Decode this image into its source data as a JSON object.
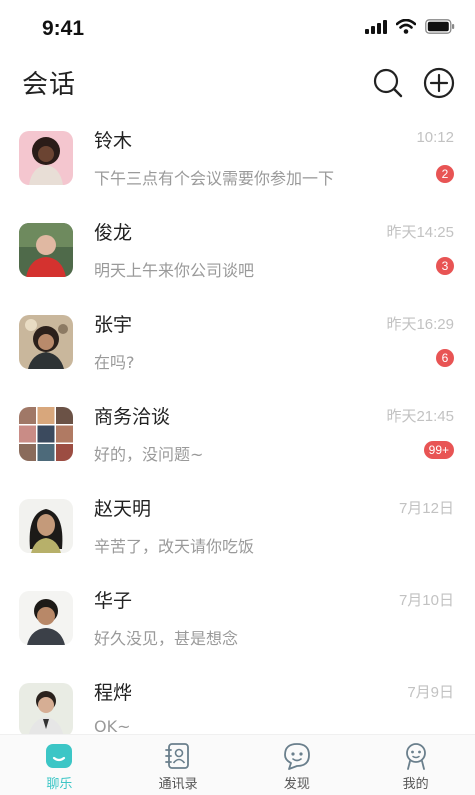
{
  "status_bar": {
    "time": "9:41"
  },
  "header": {
    "title": "会话",
    "search_icon": "search-icon",
    "add_icon": "plus-circle-icon"
  },
  "conversations": [
    {
      "name": "铃木",
      "message": "下午三点有个会议需要你参加一下",
      "time": "10:12",
      "badge": "2",
      "avatar": "avatar-woman-curly-hair"
    },
    {
      "name": "俊龙",
      "message": "明天上午来你公司谈吧",
      "time": "昨天14:25",
      "badge": "3",
      "avatar": "avatar-bald-man-red-shirt"
    },
    {
      "name": "张宇",
      "message": "在吗?",
      "time": "昨天16:29",
      "badge": "6",
      "avatar": "avatar-woman-glasses"
    },
    {
      "name": "商务洽谈",
      "message": "好的，没问题~",
      "time": "昨天21:45",
      "badge": "99+",
      "avatar": "avatar-group-grid"
    },
    {
      "name": "赵天明",
      "message": "辛苦了，改天请你吃饭",
      "time": "7月12日",
      "badge": "",
      "avatar": "avatar-man-long-hair"
    },
    {
      "name": "华子",
      "message": "好久没见，甚是想念",
      "time": "7月10日",
      "badge": "",
      "avatar": "avatar-smiling-man"
    },
    {
      "name": "程烨",
      "message": "OK~",
      "time": "7月9日",
      "badge": "",
      "avatar": "avatar-man-suit"
    }
  ],
  "tabs": [
    {
      "label": "聊乐",
      "icon": "chat-icon",
      "active": true
    },
    {
      "label": "通讯录",
      "icon": "contacts-icon",
      "active": false
    },
    {
      "label": "发现",
      "icon": "discover-icon",
      "active": false
    },
    {
      "label": "我的",
      "icon": "profile-icon",
      "active": false
    }
  ],
  "colors": {
    "accent": "#3cc6c6",
    "badge": "#e85454",
    "muted_text": "#9a9a9a",
    "time_text": "#c2c2c2"
  }
}
